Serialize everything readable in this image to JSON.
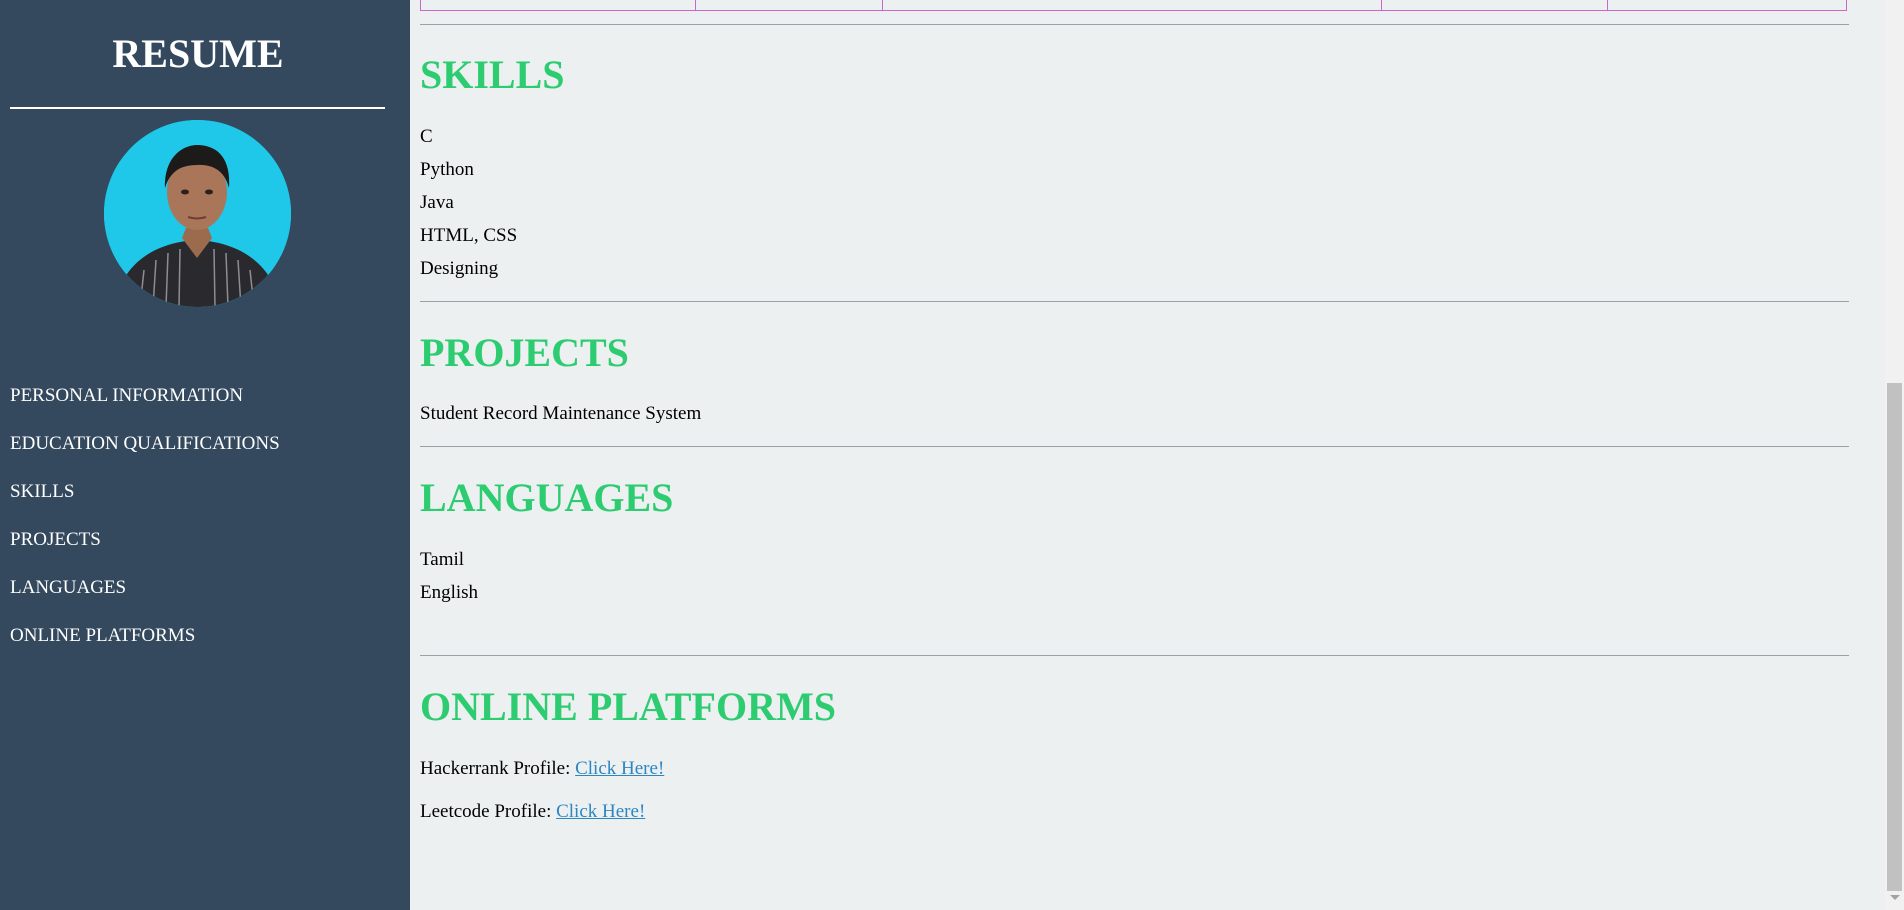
{
  "sidebar": {
    "brand": "RESUME",
    "avatar_icon": "profile-photo",
    "nav": [
      {
        "label": "PERSONAL INFORMATION"
      },
      {
        "label": "EDUCATION QUALIFICATIONS"
      },
      {
        "label": "SKILLS"
      },
      {
        "label": "PROJECTS"
      },
      {
        "label": "LANGUAGES"
      },
      {
        "label": "ONLINE PLATFORMS"
      }
    ]
  },
  "main": {
    "skills": {
      "title": "SKILLS",
      "items": [
        "C",
        "Python",
        "Java",
        "HTML, CSS",
        "Designing"
      ]
    },
    "projects": {
      "title": "PROJECTS",
      "items": [
        "Student Record Maintenance System"
      ]
    },
    "languages": {
      "title": "LANGUAGES",
      "items": [
        "Tamil",
        "English"
      ]
    },
    "online_platforms": {
      "title": "ONLINE PLATFORMS",
      "links": [
        {
          "label": "Hackerrank Profile: ",
          "link_text": "Click Here!"
        },
        {
          "label": "Leetcode Profile: ",
          "link_text": "Click Here!"
        }
      ]
    }
  },
  "colors": {
    "sidebar_bg": "#34495e",
    "page_bg": "#ecf0f1",
    "heading": "#2ecc71",
    "link": "#2e86c1",
    "table_border": "#cc66cc"
  }
}
